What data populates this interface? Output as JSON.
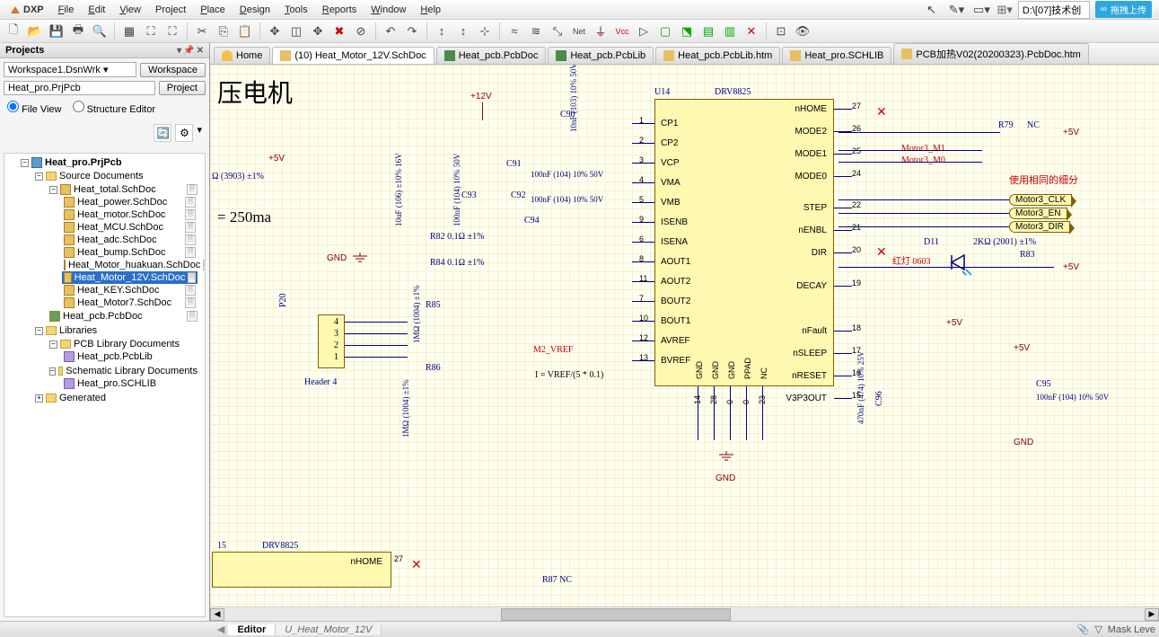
{
  "menubar": {
    "logo": "DXP",
    "items": [
      "File",
      "Edit",
      "View",
      "Project",
      "Place",
      "Design",
      "Tools",
      "Reports",
      "Window",
      "Help"
    ],
    "path": "D:\\[07]技术创",
    "cloud_label": "拖拽上传"
  },
  "sidebar": {
    "title": "Projects",
    "workspace_value": "Workspace1.DsnWrk",
    "workspace_btn": "Workspace",
    "project_value": "Heat_pro.PrjPcb",
    "project_btn": "Project",
    "radio_file": "File View",
    "radio_structure": "Structure Editor",
    "tree": {
      "root": "Heat_pro.PrjPcb",
      "source_docs_label": "Source Documents",
      "heat_total": "Heat_total.SchDoc",
      "files": [
        "Heat_power.SchDoc",
        "Heat_motor.SchDoc",
        "Heat_MCU.SchDoc",
        "Heat_adc.SchDoc",
        "Heat_bump.SchDoc",
        "Heat_Motor_huakuan.SchDoc"
      ],
      "selected": "Heat_Motor_12V.SchDoc",
      "files2": [
        "Heat_KEY.SchDoc",
        "Heat_Motor7.SchDoc"
      ],
      "pcb": "Heat_pcb.PcbDoc",
      "libraries": "Libraries",
      "pcb_lib_docs": "PCB Library Documents",
      "pcb_lib": "Heat_pcb.PcbLib",
      "sch_lib_docs": "Schematic Library Documents",
      "sch_lib": "Heat_pro.SCHLIB",
      "generated": "Generated"
    }
  },
  "tabs": [
    {
      "label": "Home",
      "type": "home"
    },
    {
      "label": "(10) Heat_Motor_12V.SchDoc",
      "type": "sch",
      "active": true
    },
    {
      "label": "Heat_pcb.PcbDoc",
      "type": "pcb"
    },
    {
      "label": "Heat_pcb.PcbLib",
      "type": "pcb"
    },
    {
      "label": "Heat_pcb.PcbLib.htm",
      "type": "doc"
    },
    {
      "label": "Heat_pro.SCHLIB",
      "type": "sch"
    },
    {
      "label": "PCB加热V02(20200323).PcbDoc.htm",
      "type": "doc"
    }
  ],
  "sch": {
    "title_cn": "压电机",
    "current": "= 250ma",
    "resistor_spec": "Ω (3903) ±1%",
    "gnd_label": "GND",
    "p20": "P20",
    "header4": "Header 4",
    "u14": "U14",
    "ic_name": "DRV8825",
    "ic_name2": "DRV8825",
    "u15": "15",
    "plus5v": "+5V",
    "plus12v": "+12V",
    "r79": "R79",
    "nc": "NC",
    "r83": "R83",
    "d11": "D11",
    "red_led": "红灯 0603",
    "same_subdiv": "使用相同的细分",
    "r85": "R85",
    "r86": "R86",
    "r82": "R82    0.1Ω ±1%",
    "r84": "R84    0.1Ω ±1%",
    "c90": "C90",
    "c91": "C91",
    "c92": "C92",
    "c93": "C93",
    "c94": "C94",
    "c95": "C95",
    "c96": "C96",
    "cap_10u": "10uF (106) ±10% 16V",
    "cap_100n_a": "100nF (104) 10% 50V",
    "cap_100n_b": "100nF (104) 10% 50V",
    "cap_100n_c": "100nF (104) 10% 50V",
    "cap_100n_d": "100nF (104) 10% 50V",
    "cap_10n": "10nF (103) 10% 50V",
    "cap_470n": "470nF (474) 10% 25V",
    "cap_100n_e": "100nF (104) 10% 50V",
    "r_2k": "2KΩ (2001) ±1%",
    "mega1_a": "1MΩ (1004) ±1%",
    "mega1_b": "1MΩ (1004) ±1%",
    "vref_formula": "I = VREF/(5 * 0.1)",
    "m2_vref": "M2_VREF",
    "motor3_m1": "Motor3_M1",
    "motor3_m0": "Motor3_M0",
    "motor3_clk": "Motor3_CLK",
    "motor3_en": "Motor3_EN",
    "motor3_dir": "Motor3_DIR",
    "nhome2": "nHOME",
    "r87": "R87  NC",
    "pins_left": [
      "CP1",
      "CP2",
      "VCP",
      "VMA",
      "VMB",
      "ISENB",
      "ISENA",
      "AOUT1",
      "AOUT2",
      "BOUT2",
      "BOUT1",
      "AVREF",
      "BVREF"
    ],
    "pins_right": [
      "nHOME",
      "MODE2",
      "MODE1",
      "MODE0",
      "STEP",
      "nENBL",
      "DIR",
      "DECAY",
      "nFault",
      "nSLEEP",
      "nRESET",
      "V3P3OUT"
    ],
    "pins_bot": [
      "GND",
      "GND",
      "GND",
      "PPAD",
      "NC"
    ],
    "pin_nums_left": [
      "1",
      "2",
      "3",
      "4",
      "5",
      "9",
      "6",
      "8",
      "11",
      "7",
      "10",
      "12",
      "13"
    ],
    "pin_nums_right": [
      "27",
      "26",
      "25",
      "24",
      "22",
      "21",
      "20",
      "19",
      "18",
      "17",
      "16",
      "15"
    ],
    "pin_nums_bot": [
      "14",
      "28",
      "0",
      "0",
      "23"
    ]
  },
  "footer": {
    "editor_tab": "Editor",
    "sheet_tab": "U_Heat_Motor_12V",
    "mask_level": "Mask Leve"
  }
}
